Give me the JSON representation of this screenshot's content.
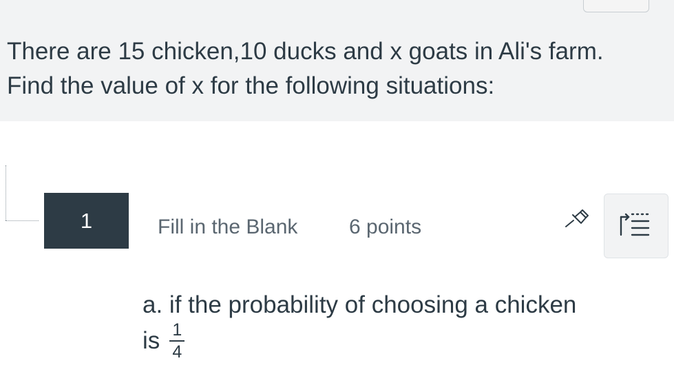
{
  "stimulus": {
    "text": "There are 15 chicken,10 ducks and x goats in Ali's farm. Find the value of x for the following situations:"
  },
  "question": {
    "number": "1",
    "type_label": "Fill in the Blank",
    "points_label": "6 points",
    "text": "a. if the probability of choosing a chicken",
    "text_continued": "is",
    "fraction": {
      "numerator": "1",
      "denominator": "4"
    }
  },
  "icons": {
    "pin": "pin-icon",
    "list": "list-indent-icon"
  },
  "colors": {
    "dark": "#2d3b45",
    "stimulus_bg": "#f2f3f4",
    "muted_text": "#5a6670"
  }
}
